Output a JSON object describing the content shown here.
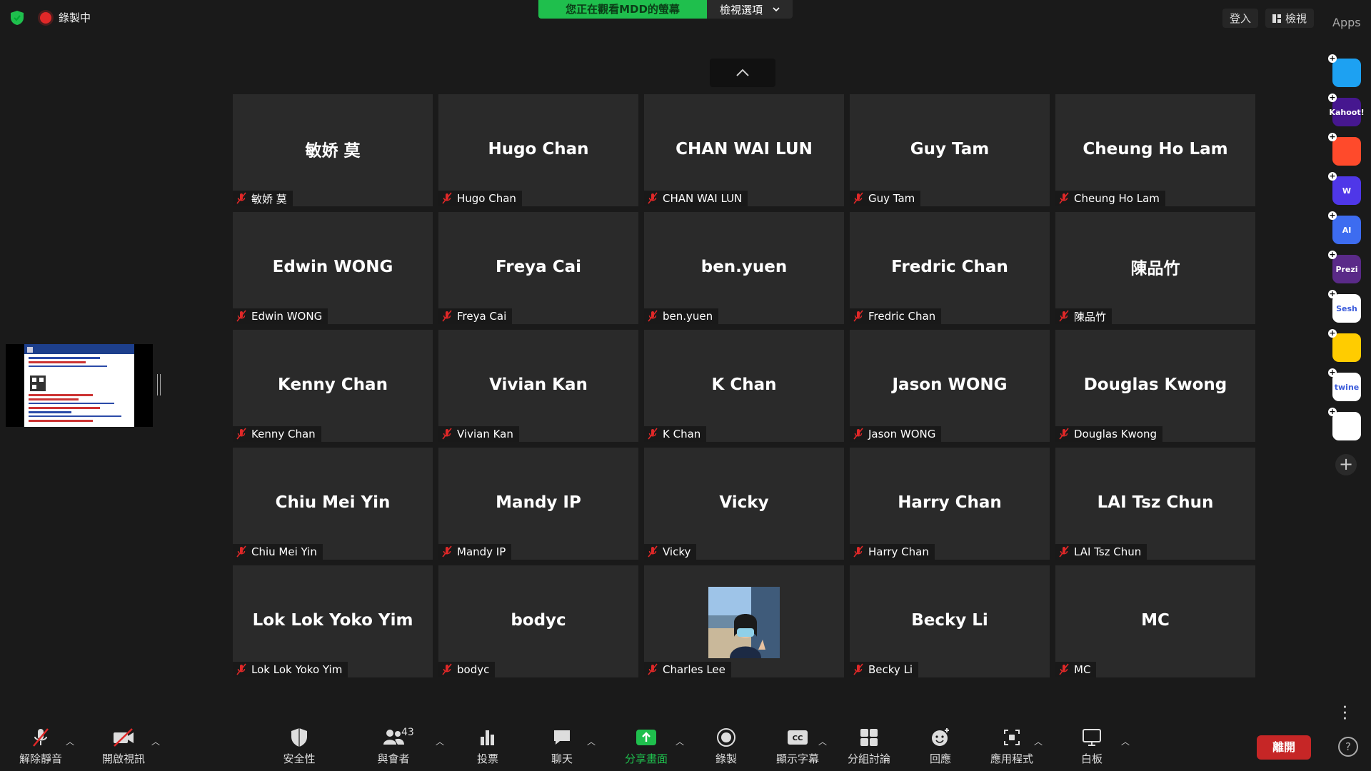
{
  "topbar": {
    "recording_label": "錄製中",
    "viewing_banner": "您正在觀看MDD的螢幕",
    "view_options": "檢視選項",
    "login": "登入",
    "view": "檢視",
    "apps": "Apps"
  },
  "participants": [
    {
      "display": "敏娇 莫",
      "label": "敏娇 莫"
    },
    {
      "display": "Hugo Chan",
      "label": "Hugo Chan"
    },
    {
      "display": "CHAN WAI LUN",
      "label": "CHAN WAI LUN"
    },
    {
      "display": "Guy Tam",
      "label": "Guy Tam"
    },
    {
      "display": "Cheung Ho Lam",
      "label": "Cheung Ho Lam"
    },
    {
      "display": "Edwin WONG",
      "label": "Edwin WONG"
    },
    {
      "display": "Freya Cai",
      "label": "Freya Cai"
    },
    {
      "display": "ben.yuen",
      "label": "ben.yuen"
    },
    {
      "display": "Fredric Chan",
      "label": "Fredric Chan"
    },
    {
      "display": "陳品竹",
      "label": "陳品竹"
    },
    {
      "display": "Kenny Chan",
      "label": "Kenny Chan"
    },
    {
      "display": "Vivian Kan",
      "label": "Vivian Kan"
    },
    {
      "display": "K Chan",
      "label": "K Chan"
    },
    {
      "display": "Jason WONG",
      "label": "Jason WONG"
    },
    {
      "display": "Douglas Kwong",
      "label": "Douglas Kwong"
    },
    {
      "display": "Chiu Mei Yin",
      "label": "Chiu Mei Yin"
    },
    {
      "display": "Mandy IP",
      "label": "Mandy IP"
    },
    {
      "display": "Vicky",
      "label": "Vicky"
    },
    {
      "display": "Harry Chan",
      "label": "Harry Chan"
    },
    {
      "display": "LAI Tsz Chun",
      "label": "LAI Tsz Chun"
    },
    {
      "display": "Lok Lok Yoko Yim",
      "label": "Lok Lok Yoko Yim"
    },
    {
      "display": "bodyc",
      "label": "bodyc"
    },
    {
      "display": "",
      "label": "Charles Lee"
    },
    {
      "display": "Becky Li",
      "label": "Becky Li"
    },
    {
      "display": "MC",
      "label": "MC"
    }
  ],
  "apps_rail": [
    {
      "icon": "slido-icon",
      "color": "#1da1f2",
      "text": ""
    },
    {
      "icon": "kahoot-icon",
      "color": "#46178f",
      "text": "Kahoot!"
    },
    {
      "icon": "clipchamp-icon",
      "color": "#ff4a2b",
      "text": ""
    },
    {
      "icon": "wordwall-icon",
      "color": "#4f37e8",
      "text": "W"
    },
    {
      "icon": "ai-assistant-icon",
      "color": "#3d6cf0",
      "text": "AI"
    },
    {
      "icon": "prezi-icon",
      "color": "#5a2a88",
      "text": "Prezi"
    },
    {
      "icon": "sesh-icon",
      "color": "#ffffff",
      "text": "Sesh"
    },
    {
      "icon": "emoji-app-icon",
      "color": "#ffcc00",
      "text": ""
    },
    {
      "icon": "twine-icon",
      "color": "#ffffff",
      "text": "twine"
    },
    {
      "icon": "blocks-app-icon",
      "color": "#ffffff",
      "text": ""
    }
  ],
  "toolbar": {
    "unmute": "解除靜音",
    "start_video": "開啟視訊",
    "security": "安全性",
    "participants": "與會者",
    "participant_count": "43",
    "polls": "投票",
    "chat": "聊天",
    "share_screen": "分享畫面",
    "record": "錄製",
    "captions": "顯示字幕",
    "breakout": "分組討論",
    "reactions": "回應",
    "apps": "應用程式",
    "whiteboard": "白板",
    "leave": "離開",
    "help": "?"
  },
  "colors": {
    "accent_green": "#1fbf4d",
    "leave_red": "#c62626",
    "mute_red": "#e02828",
    "tile_bg": "#2a2a2a"
  }
}
